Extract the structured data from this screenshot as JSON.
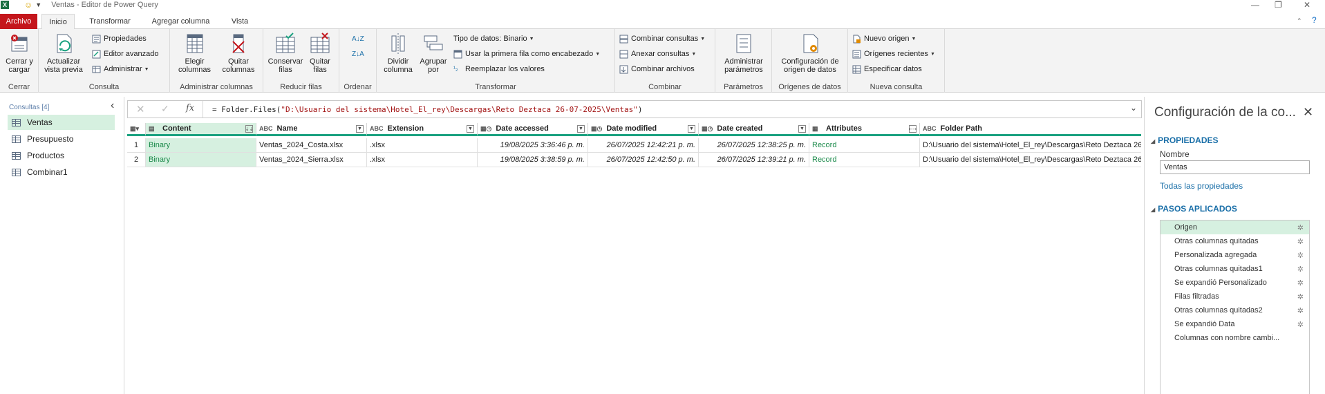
{
  "window": {
    "title": "Ventas - Editor de Power Query",
    "app_icon": "X",
    "minimize": "—",
    "restore": "❐",
    "close": "✕"
  },
  "tabs": [
    "Archivo",
    "Inicio",
    "Transformar",
    "Agregar columna",
    "Vista"
  ],
  "help": "?",
  "ribbon": {
    "cerrar": {
      "label": "Cerrar",
      "close_load": "Cerrar y\ncargar"
    },
    "consulta": {
      "label": "Consulta",
      "refresh": "Actualizar\nvista previa",
      "properties": "Propiedades",
      "advanced_editor": "Editor avanzado",
      "manage": "Administrar"
    },
    "admin_cols": {
      "label": "Administrar columnas",
      "choose": "Elegir\ncolumnas",
      "remove": "Quitar\ncolumnas"
    },
    "reduce_rows": {
      "label": "Reducir filas",
      "keep": "Conservar\nfilas",
      "remove": "Quitar\nfilas"
    },
    "sort": {
      "label": "Ordenar"
    },
    "transform": {
      "label": "Transformar",
      "split": "Dividir\ncolumna",
      "group": "Agrupar\npor",
      "datatype": "Tipo de datos: Binario",
      "first_row": "Usar la primera fila como encabezado",
      "replace": "Reemplazar los valores"
    },
    "combine": {
      "label": "Combinar",
      "merge": "Combinar consultas",
      "append": "Anexar consultas",
      "files": "Combinar archivos"
    },
    "params": {
      "label": "Parámetros",
      "manage": "Administrar\nparámetros"
    },
    "sources": {
      "label": "Orígenes de datos",
      "config": "Configuración de\norigen de datos"
    },
    "new_query": {
      "label": "Nueva consulta",
      "new_source": "Nuevo origen",
      "recent": "Orígenes recientes",
      "enter": "Especificar datos"
    }
  },
  "queries": {
    "header": "Consultas [4]",
    "items": [
      "Ventas",
      "Presupuesto",
      "Productos",
      "Combinar1"
    ]
  },
  "formula": {
    "prefix": "= Folder.Files(",
    "path": "\"D:\\Usuario del sistema\\Hotel_El_rey\\Descargas\\Reto Deztaca 26-07-2025\\Ventas\"",
    "suffix": ")"
  },
  "table": {
    "columns": [
      {
        "name": "Content",
        "type": "binary-icon"
      },
      {
        "name": "Name",
        "type": "ABC"
      },
      {
        "name": "Extension",
        "type": "ABC"
      },
      {
        "name": "Date accessed",
        "type": "datetime-icon"
      },
      {
        "name": "Date modified",
        "type": "datetime-icon"
      },
      {
        "name": "Date created",
        "type": "datetime-icon"
      },
      {
        "name": "Attributes",
        "type": "table-icon"
      },
      {
        "name": "Folder Path",
        "type": "ABC"
      }
    ],
    "rows": [
      [
        "1",
        "Binary",
        "Ventas_2024_Costa.xlsx",
        ".xlsx",
        "19/08/2025 3:36:46 p. m.",
        "26/07/2025 12:42:21 p. m.",
        "26/07/2025 12:38:25 p. m.",
        "Record",
        "D:\\Usuario del sistema\\Hotel_El_rey\\Descargas\\Reto Deztaca 26"
      ],
      [
        "2",
        "Binary",
        "Ventas_2024_Sierra.xlsx",
        ".xlsx",
        "19/08/2025 3:38:59 p. m.",
        "26/07/2025 12:42:50 p. m.",
        "26/07/2025 12:39:21 p. m.",
        "Record",
        "D:\\Usuario del sistema\\Hotel_El_rey\\Descargas\\Reto Deztaca 26"
      ]
    ]
  },
  "settings": {
    "title": "Configuración de la co...",
    "properties_header": "PROPIEDADES",
    "name_label": "Nombre",
    "name_value": "Ventas",
    "all_props": "Todas las propiedades",
    "steps_header": "PASOS APLICADOS",
    "steps": [
      "Origen",
      "Otras columnas quitadas",
      "Personalizada agregada",
      "Otras columnas quitadas1",
      "Se expandió Personalizado",
      "Filas filtradas",
      "Otras columnas quitadas2",
      "Se expandió Data",
      "Columnas con nombre cambi..."
    ]
  },
  "colors": {
    "accent_green": "#19a17f",
    "selection": "#d6f0e0",
    "archivo_tab": "#c4161c",
    "link_blue": "#1a6fa8"
  }
}
